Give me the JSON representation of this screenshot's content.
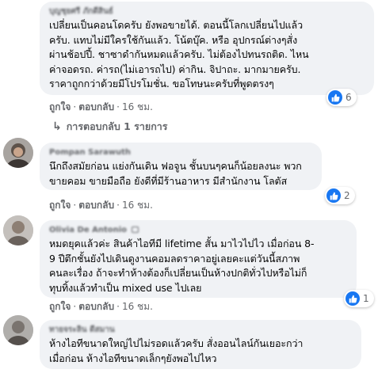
{
  "comments": [
    {
      "author": "บุญชุยศรี ภักดีสินธ์",
      "text": "เปลี่ยนเป็นคอนโดครับ ยังพอขายได้. ตอนนี้โลกเปลี่ยนไปแล้ว\nครับ. แทบไม่มีใครใช้กันแล้ว. โน้ตบุ๊ค. หรือ อุปกรณ์ต่างๆสั่ง\nผ่านช้อปปี้. ชาซาดำกันหมดแล้วครับ. ไม่ต้องไปทนรถติด. ไหน\nค่าจอดรถ. ค่ารถ(ไม่เอารถไป) ค่ากิน. จิปาถะ. มากมายครับ.\nราคาถูกกว่าด้วยมีโปรโมชั่น. ขอโทษนะครับที่พูดตรงๆ",
      "like_label": "ถูกใจ",
      "reply_label": "ตอบกลับ",
      "time": "16 ชม.",
      "reactions": "6",
      "replies_link": "การตอบกลับ 1 รายการ"
    },
    {
      "author": "Pompan Sarawuth",
      "text": "นึกถึงสมัยก่อน แย่งกันเดิน ฟอจูน ชั้นบนๆคนก็น้อยลงนะ พวก\nขายคอม ขายมือถือ ยังดีที่มีร้านอาหาร มีสำนักงาน โลตัส",
      "like_label": "ถูกใจ",
      "reply_label": "ตอบกลับ",
      "time": "16 ชม.",
      "reactions": "2"
    },
    {
      "author": "Olivia De Antonio",
      "text": "หมดยุคแล้วค่ะ สินค้าไอทีมี lifetime สั้น มาไวไปไว เมื่อก่อน 8-\n9 ปีตึกชั้นยังไปเดินดูงานคอมลดราคาอยู่เลยคะแต่วันนี้สภาพ\nคนละเรื่อง ถ้าจะทำห้างต้องก็เปลี่ยนเป็นห้างปกติทั่วไปหรือไม่ก็\nทุบทิ้งแล้วทำเป็น mixed use ไปเลย",
      "like_label": "ถูกใจ",
      "reply_label": "ตอบกลับ",
      "time": "16 ชม.",
      "reactions": "1"
    },
    {
      "author": "ทายจระลิน ดีสมาน",
      "text": "ห้างไอทีขนาดใหญ่ไปไม่รอดแล้วครับ สั่งออนไลน์กันเยอะกว่า\nเมื่อก่อน ห้างไอทีขนาดเล็กๆยังพอไปไหว"
    }
  ],
  "colors": {
    "bubble": "#f0f2f5",
    "like_blue": "#1877f2",
    "meta_gray": "#65676b"
  }
}
